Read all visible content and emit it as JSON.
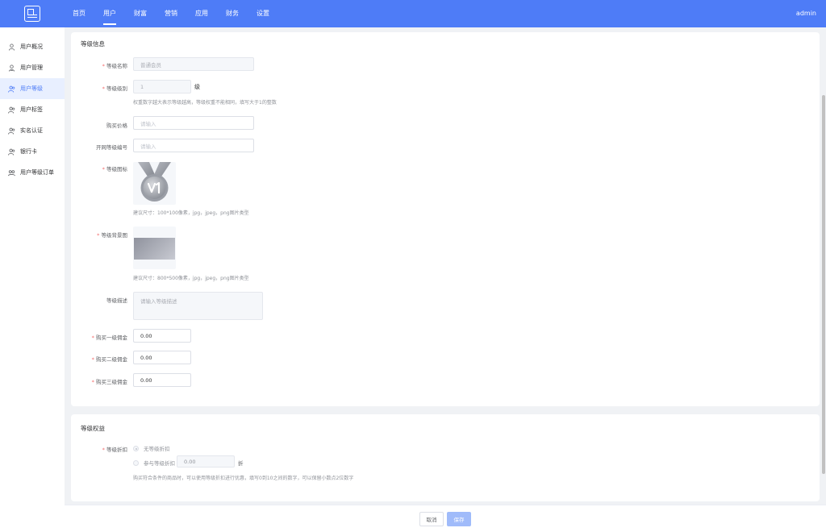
{
  "header": {
    "nav": [
      "首页",
      "用户",
      "财富",
      "营销",
      "应用",
      "财务",
      "设置"
    ],
    "user": "admin"
  },
  "sidebar": {
    "items": [
      {
        "label": "用户概况",
        "icon": "user-icon"
      },
      {
        "label": "用户管理",
        "icon": "user-manage-icon"
      },
      {
        "label": "用户等级",
        "icon": "user-level-icon"
      },
      {
        "label": "用户标签",
        "icon": "users-tag-icon"
      },
      {
        "label": "实名认证",
        "icon": "users-verify-icon"
      },
      {
        "label": "银行卡",
        "icon": "users-bankcard-icon"
      },
      {
        "label": "用户等级订单",
        "icon": "users-order-icon"
      }
    ],
    "active_index": 2
  },
  "level_info": {
    "title": "等级信息",
    "name_label": "等级名称",
    "name_value": "普通会员",
    "weight_label": "等级级别",
    "weight_value": "1",
    "weight_unit": "级",
    "weight_hint": "权重数字越大表示等级越高，等级权重不能相同，填写大于1的整数",
    "price_label": "购买价格",
    "price_placeholder": "请输入",
    "code_label": "开网等级编号",
    "code_placeholder": "请输入",
    "icon_label": "等级图标",
    "icon_hint": "建议尺寸：100*100像素，jpg，jpeg，png图片类型",
    "bg_label": "等级背景图",
    "bg_hint": "建议尺寸：800*500像素，jpg，jpeg，png图片类型",
    "desc_label": "等级描述",
    "desc_placeholder": "请输入等级描述",
    "commission1_label": "购买一级佣金",
    "commission1_value": "0.00",
    "commission2_label": "购买二级佣金",
    "commission2_value": "0.00",
    "commission3_label": "购买三级佣金",
    "commission3_value": "0.00"
  },
  "level_rights": {
    "title": "等级权益",
    "discount_label": "等级折扣",
    "option_none": "无等级折扣",
    "option_join": "参与等级折扣",
    "discount_value": "0.00",
    "discount_unit": "折",
    "discount_hint": "购买符合条件的商品时，可以使用等级折扣进行优惠，填写0到10之间的数字，可以保留小数点2位数字"
  },
  "footer": {
    "cancel": "取消",
    "save": "保存"
  },
  "colors": {
    "primary": "#4e7cf7",
    "required": "#f56c6c"
  }
}
